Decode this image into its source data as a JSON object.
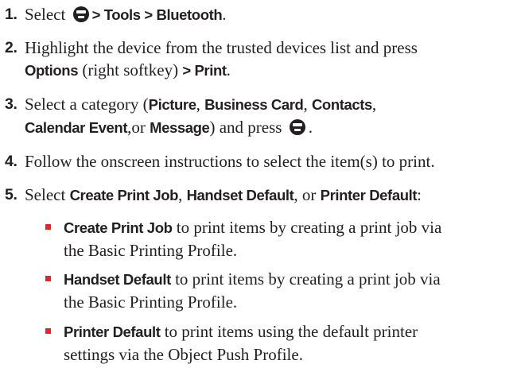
{
  "steps": [
    {
      "number": "1.",
      "p1": "Select ",
      "p2": "> Tools > Bluetooth",
      "p3": "."
    },
    {
      "number": "2.",
      "p1": "Highlight the device from the trusted devices list and press",
      "p2": "Options",
      "p3": " (right softkey) ",
      "p4": "> Print",
      "p5": "."
    },
    {
      "number": "3.",
      "p1": "Select a category (",
      "p2": "Picture",
      "p3": ", ",
      "p4": "Business Card",
      "p5": ", ",
      "p6": "Contacts",
      "p7": ",",
      "p8": "Calendar Event",
      "p9": ",or ",
      "p10": "Message",
      "p11": ") and press ",
      "p12": "."
    },
    {
      "number": "4.",
      "p1": "Follow the onscreen instructions to select the item(s) to print."
    },
    {
      "number": "5.",
      "p1": "Select ",
      "p2": "Create Print Job",
      "p3": ", ",
      "p4": "Handset Default",
      "p5": ", or ",
      "p6": "Printer Default",
      "p7": ":"
    }
  ],
  "bullets": [
    {
      "term": "Create Print Job",
      "l1": " to print items by creating a print job via",
      "l2": "the Basic Printing Profile."
    },
    {
      "term": "Handset Default",
      "l1": " to print items by creating a print job via",
      "l2": "the Basic Printing Profile."
    },
    {
      "term": "Printer Default",
      "l1": " to print items using the default printer",
      "l2": "settings via the Object Push Profile."
    }
  ],
  "icons": {
    "menu_ok_key": "menu-ok-key-icon"
  },
  "colors": {
    "text": "#231f20",
    "bullet": "#e4262c"
  }
}
